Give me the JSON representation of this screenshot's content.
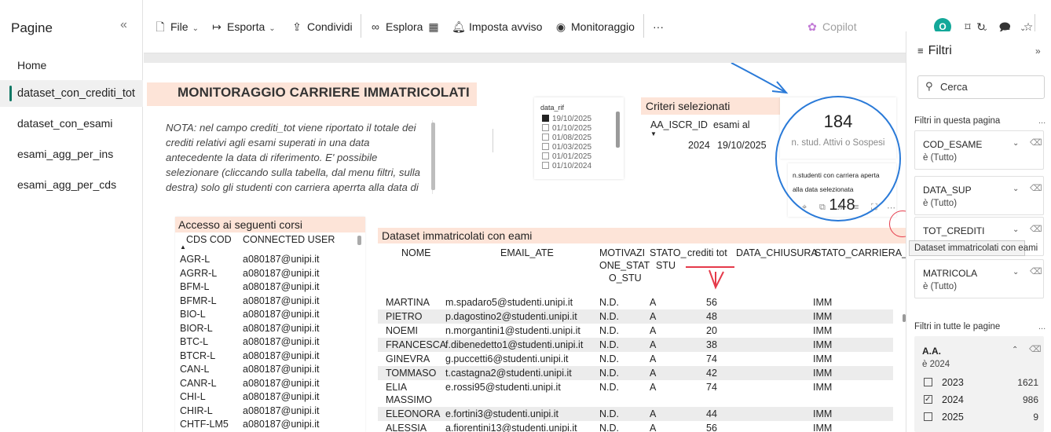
{
  "pages": {
    "title": "Pagine",
    "collapse_icon": "«",
    "items": [
      {
        "label": "Home"
      },
      {
        "label": "dataset_con_crediti_tot",
        "active": true
      },
      {
        "label": "dataset_con_esami"
      },
      {
        "label": "esami_agg_per_ins"
      },
      {
        "label": "esami_agg_per_cds"
      }
    ]
  },
  "toolbar": {
    "file": "File",
    "esporta": "Esporta",
    "condividi": "Condividi",
    "esplora": "Esplora",
    "imposta_avviso": "Imposta avviso",
    "monitoraggio": "Monitoraggio",
    "more": "···",
    "copilot": "Copilot",
    "avatar_letter": "O"
  },
  "report": {
    "title": "MONITORAGGIO CARRIERE IMMATRICOLATI",
    "nota": "NOTA: nel campo crediti_tot viene riportato il totale  dei crediti relativi agli esami superati in una data antecedente la data di riferimento.  E' possibile selezionare (cliccando sulla tabella, dal menu filtri, sulla destra) solo gli studenti con carriera aperrta alla data di",
    "slicer": {
      "label": "data_rif",
      "options": [
        "19/10/2025",
        "01/10/2025",
        "01/08/2025",
        "01/03/2025",
        "01/01/2025",
        "01/10/2024"
      ]
    },
    "criteri": {
      "title": "Criteri selezionati",
      "col1": "AA_ISCR_ID",
      "col2": "esami al",
      "val1": "2024",
      "val2": "19/10/2025"
    },
    "card1": {
      "value": "184",
      "label": "n. stud. Attivi o Sospesi"
    },
    "card2": {
      "label1": "n.studenti con carriera aperta",
      "label2": "alla data selezionata",
      "value": "148"
    },
    "corsi": {
      "title": "Accesso ai seguenti corsi",
      "col1": "CDS COD",
      "col2": "CONNECTED USER",
      "rows": [
        [
          "AGR-L",
          "a080187@unipi.it"
        ],
        [
          "AGRR-L",
          "a080187@unipi.it"
        ],
        [
          "BFM-L",
          "a080187@unipi.it"
        ],
        [
          "BFMR-L",
          "a080187@unipi.it"
        ],
        [
          "BIO-L",
          "a080187@unipi.it"
        ],
        [
          "BIOR-L",
          "a080187@unipi.it"
        ],
        [
          "BTC-L",
          "a080187@unipi.it"
        ],
        [
          "BTCR-L",
          "a080187@unipi.it"
        ],
        [
          "CAN-L",
          "a080187@unipi.it"
        ],
        [
          "CANR-L",
          "a080187@unipi.it"
        ],
        [
          "CHI-L",
          "a080187@unipi.it"
        ],
        [
          "CHIR-L",
          "a080187@unipi.it"
        ],
        [
          "CHTF-LM5",
          "a080187@unipi.it"
        ]
      ]
    },
    "dataset": {
      "title": "Dataset immatricolati con eami",
      "headers": {
        "nome": "NOME",
        "email": "EMAIL_ATE",
        "motiv1": "MOTIVAZI",
        "motiv2": "ONE_STAT",
        "motiv3": "O_STU",
        "stato1": "STATO_",
        "stato2": "STU",
        "crediti": "crediti tot",
        "chiusura": "DATA_CHIUSURA",
        "carriera": "STATO_CARRIERA_C"
      },
      "rows": [
        [
          "MARTINA",
          "m.spadaro5@studenti.unipi.it",
          "N.D.",
          "A",
          "56",
          "IMM"
        ],
        [
          "PIETRO",
          "p.dagostino2@studenti.unipi.it",
          "N.D.",
          "A",
          "48",
          "IMM"
        ],
        [
          "NOEMI",
          "n.morgantini1@studenti.unipi.it",
          "N.D.",
          "A",
          "20",
          "IMM"
        ],
        [
          "FRANCESCA",
          "f.dibenedetto1@studenti.unipi.it",
          "N.D.",
          "A",
          "38",
          "IMM"
        ],
        [
          "GINEVRA",
          "g.puccetti6@studenti.unipi.it",
          "N.D.",
          "A",
          "74",
          "IMM"
        ],
        [
          "TOMMASO",
          "t.castagna2@studenti.unipi.it",
          "N.D.",
          "A",
          "42",
          "IMM"
        ],
        [
          "ELIA",
          "e.rossi95@studenti.unipi.it",
          "N.D.",
          "A",
          "74",
          "IMM",
          "MASSIMO"
        ],
        [
          "ELEONORA",
          "e.fortini3@studenti.unipi.it",
          "N.D.",
          "A",
          "44",
          "IMM"
        ],
        [
          "ALESSIA",
          "a.fiorentini13@studenti.unipi.it",
          "N.D.",
          "A",
          "56",
          "IMM"
        ]
      ]
    }
  },
  "filters": {
    "title": "Filtri",
    "expand_icon": "»",
    "search_placeholder": "Cerca",
    "section_page": "Filtri in questa pagina",
    "section_all": "Filtri in tutte le pagine",
    "dots": "...",
    "cards": [
      {
        "name": "COD_ESAME",
        "value": "è (Tutto)"
      },
      {
        "name": "DATA_SUP",
        "value": "è (Tutto)"
      },
      {
        "name": "TOT_CREDITI",
        "value": ""
      },
      {
        "name": "MATRICOLA",
        "value": "è (Tutto)"
      }
    ],
    "aa": {
      "name": "A.A.",
      "value": "è 2024",
      "options": [
        {
          "label": "2023",
          "count": "1621",
          "checked": false
        },
        {
          "label": "2024",
          "count": "986",
          "checked": true
        },
        {
          "label": "2025",
          "count": "9",
          "checked": false
        }
      ]
    },
    "tooltip": "Dataset immatricolati con eami"
  },
  "colors": {
    "accent_header": "#fde4d8",
    "annotation_blue": "#2a7ad8",
    "annotation_red": "#e53a4a",
    "active_bar": "#117865"
  }
}
